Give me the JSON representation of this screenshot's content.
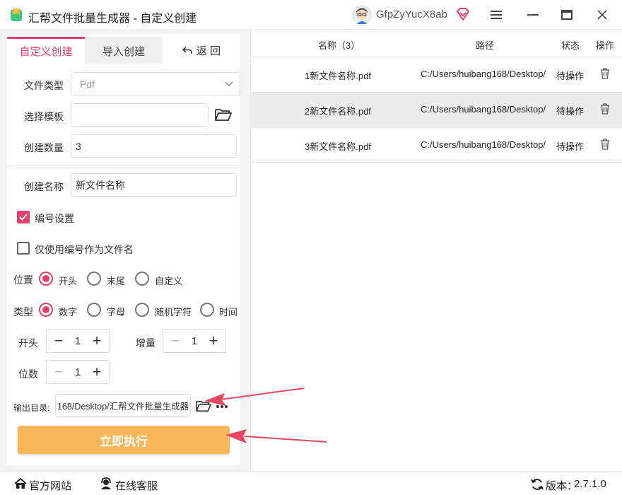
{
  "window": {
    "title": "汇帮文件批量生成器 - 自定义创建",
    "user_name": "GfpZyYucX8ab"
  },
  "tabs": {
    "custom": "自定义创建",
    "import": "导入创建",
    "back": "返 回"
  },
  "form": {
    "file_type_label": "文件类型",
    "file_type_value": "Pdf",
    "template_label": "选择模板",
    "template_value": "",
    "count_label": "创建数量",
    "count_value": "3",
    "name_label": "创建名称",
    "name_value": "新文件名称",
    "numbering_label": "编号设置",
    "numbering_checked": true,
    "only_number_label": "仅使用编号作为文件名",
    "only_number_checked": false,
    "position_label": "位置",
    "position_options": [
      "开头",
      "末尾",
      "自定义"
    ],
    "position_selected": "开头",
    "type_label": "类型",
    "type_options": [
      "数字",
      "字母",
      "随机字符",
      "时间"
    ],
    "type_selected": "数字",
    "start_label": "开头",
    "start_value": "1",
    "increment_label": "增量",
    "increment_value": "1",
    "digits_label": "位数",
    "digits_value": "1",
    "output_label": "输出目录:",
    "output_value": "168/Desktop/汇帮文件批量生成器",
    "run_label": "立即执行"
  },
  "table": {
    "headers": {
      "name": "名称（3）",
      "path": "路径",
      "status": "状态",
      "action": "操作"
    },
    "rows": [
      {
        "name": "1新文件名称.pdf",
        "path": "C:/Users/huibang168/Desktop/",
        "status": "待操作"
      },
      {
        "name": "2新文件名称.pdf",
        "path": "C:/Users/huibang168/Desktop/",
        "status": "待操作"
      },
      {
        "name": "3新文件名称.pdf",
        "path": "C:/Users/huibang168/Desktop/",
        "status": "待操作"
      }
    ],
    "selected_row": 1
  },
  "statusbar": {
    "website": "官方网站",
    "support": "在线客服",
    "version_label": "版本：",
    "version_value": "2.7.1.0"
  },
  "colors": {
    "accent": "#e4406b",
    "run_button": "#f8b65a",
    "arrow": "#e8475f"
  }
}
